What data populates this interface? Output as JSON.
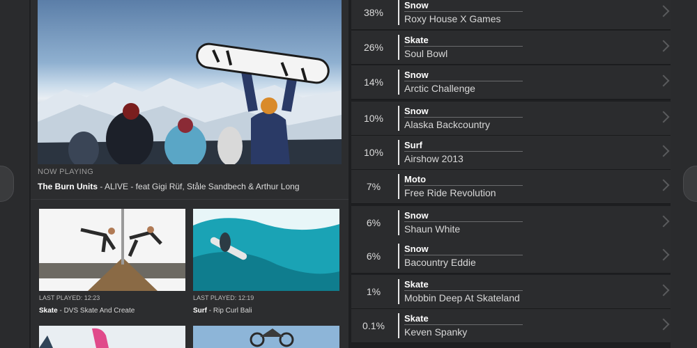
{
  "now_playing": {
    "label": "NOW PLAYING",
    "artist": "The Burn Units",
    "rest": " - ALIVE - feat Gigi Rüf, Ståle Sandbech & Arthur Long"
  },
  "videos": [
    {
      "last_played": "LAST PLAYED: 12:23",
      "category": "Skate",
      "title": " - DVS Skate And Create"
    },
    {
      "last_played": "LAST PLAYED: 12:19",
      "category": "Surf",
      "title": " - Rip Curl Bali"
    }
  ],
  "rankings": [
    {
      "pct": "38%",
      "category": "Snow",
      "name": "Roxy House X Games"
    },
    {
      "pct": "26%",
      "category": "Skate",
      "name": "Soul Bowl"
    },
    {
      "pct": "14%",
      "category": "Snow",
      "name": "Arctic Challenge"
    },
    {
      "pct": "10%",
      "category": "Snow",
      "name": "Alaska Backcountry"
    },
    {
      "pct": "10%",
      "category": "Surf",
      "name": "Airshow 2013"
    },
    {
      "pct": "7%",
      "category": "Moto",
      "name": "Free Ride Revolution"
    },
    {
      "pct": "6%",
      "category": "Snow",
      "name": "Shaun White"
    },
    {
      "pct": "6%",
      "category": "Snow",
      "name": "Bacountry Eddie"
    },
    {
      "pct": "1%",
      "category": "Skate",
      "name": "Mobbin Deep At Skateland"
    },
    {
      "pct": "0.1%",
      "category": "Skate",
      "name": "Keven Spanky"
    }
  ]
}
